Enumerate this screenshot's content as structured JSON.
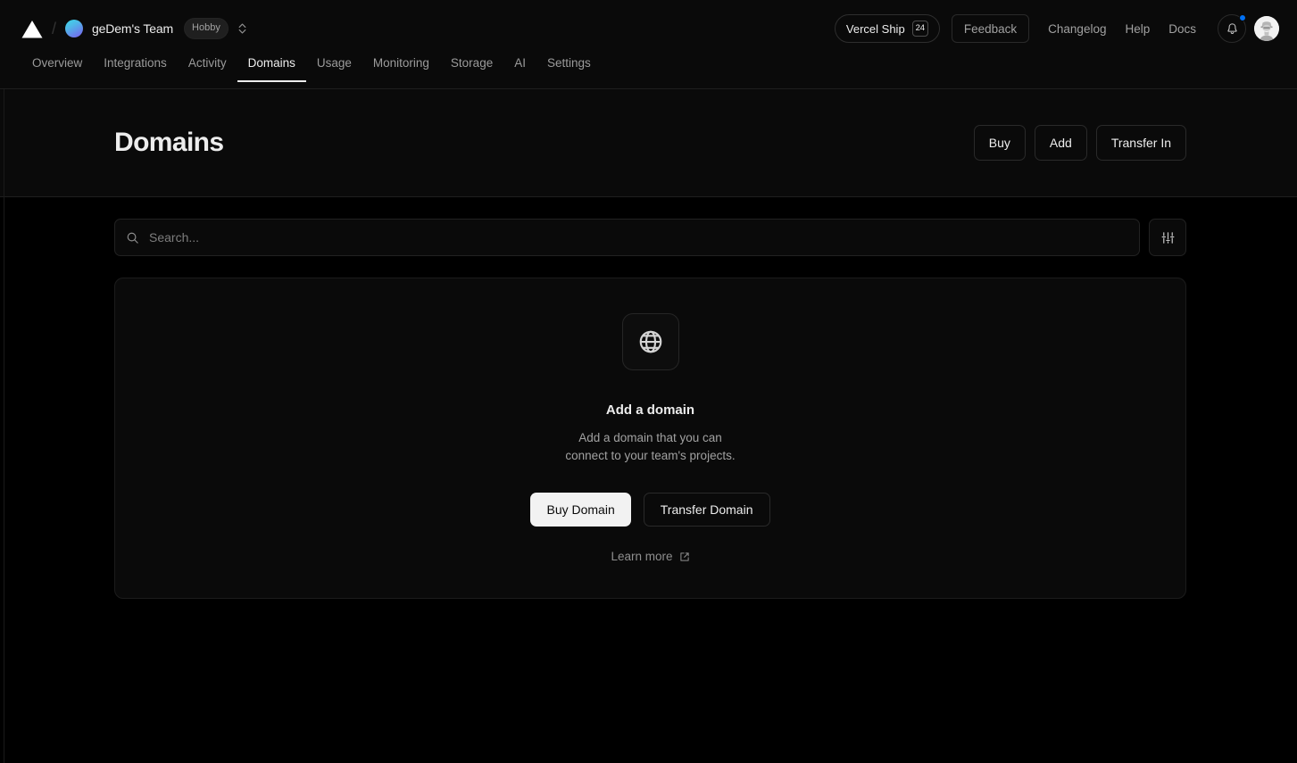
{
  "topbar": {
    "logo_icon": "vercel-triangle-logo",
    "breadcrumb_separator": "/",
    "team_name": "geDem's Team",
    "plan_badge": "Hobby",
    "team_switcher_icon": "chevron-up-down-icon",
    "ship_label": "Vercel Ship",
    "ship_badge": "24",
    "feedback_label": "Feedback",
    "links": [
      {
        "label": "Changelog"
      },
      {
        "label": "Help"
      },
      {
        "label": "Docs"
      }
    ],
    "notification_icon": "bell-icon",
    "notification_has_unread": true,
    "avatar_icon": "user-avatar"
  },
  "nav": {
    "tabs": [
      {
        "label": "Overview",
        "active": false
      },
      {
        "label": "Integrations",
        "active": false
      },
      {
        "label": "Activity",
        "active": false
      },
      {
        "label": "Domains",
        "active": true
      },
      {
        "label": "Usage",
        "active": false
      },
      {
        "label": "Monitoring",
        "active": false
      },
      {
        "label": "Storage",
        "active": false
      },
      {
        "label": "AI",
        "active": false
      },
      {
        "label": "Settings",
        "active": false
      }
    ]
  },
  "header": {
    "title": "Domains",
    "actions": [
      {
        "label": "Buy"
      },
      {
        "label": "Add"
      },
      {
        "label": "Transfer In"
      }
    ]
  },
  "toolbar": {
    "search_placeholder": "Search...",
    "search_value": "",
    "search_icon": "search-icon",
    "filter_icon": "sliders-filter-icon"
  },
  "empty_state": {
    "icon": "globe-icon",
    "title": "Add a domain",
    "description_line1": "Add a domain that you can",
    "description_line2": "connect to your team's projects.",
    "primary_button": "Buy Domain",
    "secondary_button": "Transfer Domain",
    "learn_more_label": "Learn more",
    "learn_more_icon": "external-link-icon"
  },
  "colors": {
    "background": "#000000",
    "surface": "#0a0a0a",
    "border": "#1f1f1f",
    "text_primary": "#ededed",
    "text_secondary": "#a1a1a1",
    "accent_blue": "#0070f3"
  }
}
